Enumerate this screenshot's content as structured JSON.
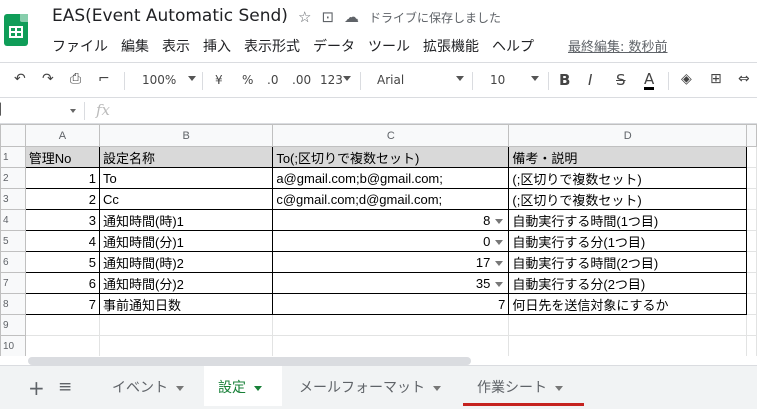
{
  "app": {
    "title": "EAS(Event Automatic Send)",
    "saved_status": "ドライブに保存しました",
    "last_edit": "最終編集: 数秒前"
  },
  "menu": [
    "ファイル",
    "編集",
    "表示",
    "挿入",
    "表示形式",
    "データ",
    "ツール",
    "拡張機能",
    "ヘルプ"
  ],
  "toolbar": {
    "zoom": "100%",
    "currency": "¥",
    "percent": "%",
    "decrease_decimal": ".0",
    "increase_decimal": ".00",
    "more_formats": "123",
    "font": "Arial",
    "font_size": "10",
    "bold": "B",
    "italic": "I",
    "strike": "S",
    "text_color": "A",
    "accent_color": "#000000"
  },
  "formula_bar": {
    "fx": "fx",
    "value": ""
  },
  "sheet": {
    "columns": [
      "A",
      "B",
      "C",
      "D"
    ],
    "row_numbers": [
      "1",
      "2",
      "3",
      "4",
      "5",
      "6",
      "7",
      "8",
      "9",
      "10"
    ],
    "rows": [
      {
        "a": "管理No",
        "b": "設定名称",
        "c": "To(;区切りで複数セット)",
        "d": "備考・説明"
      },
      {
        "a": "1",
        "b": "To",
        "c": "a@gmail.com;b@gmail.com;",
        "d": "(;区切りで複数セット)"
      },
      {
        "a": "2",
        "b": "Cc",
        "c": "c@gmail.com;d@gmail.com;",
        "d": "(;区切りで複数セット)"
      },
      {
        "a": "3",
        "b": "通知時間(時)1",
        "c": "8",
        "d": "自動実行する時間(1つ目)"
      },
      {
        "a": "4",
        "b": "通知時間(分)1",
        "c": "0",
        "d": "自動実行する分(1つ目)"
      },
      {
        "a": "5",
        "b": "通知時間(時)2",
        "c": "17",
        "d": "自動実行する時間(2つ目)"
      },
      {
        "a": "6",
        "b": "通知時間(分)2",
        "c": "35",
        "d": "自動実行する分(2つ目)"
      },
      {
        "a": "7",
        "b": "事前通知日数",
        "c": "7",
        "d": "何日先を送信対象にするか"
      }
    ]
  },
  "tabs": [
    {
      "label": "イベント"
    },
    {
      "label": "設定"
    },
    {
      "label": "メールフォーマット"
    },
    {
      "label": "作業シート"
    }
  ],
  "colors": {
    "brand": "#0f9d58",
    "active_tab": "#188038",
    "tab_underline": "#c5221f"
  }
}
